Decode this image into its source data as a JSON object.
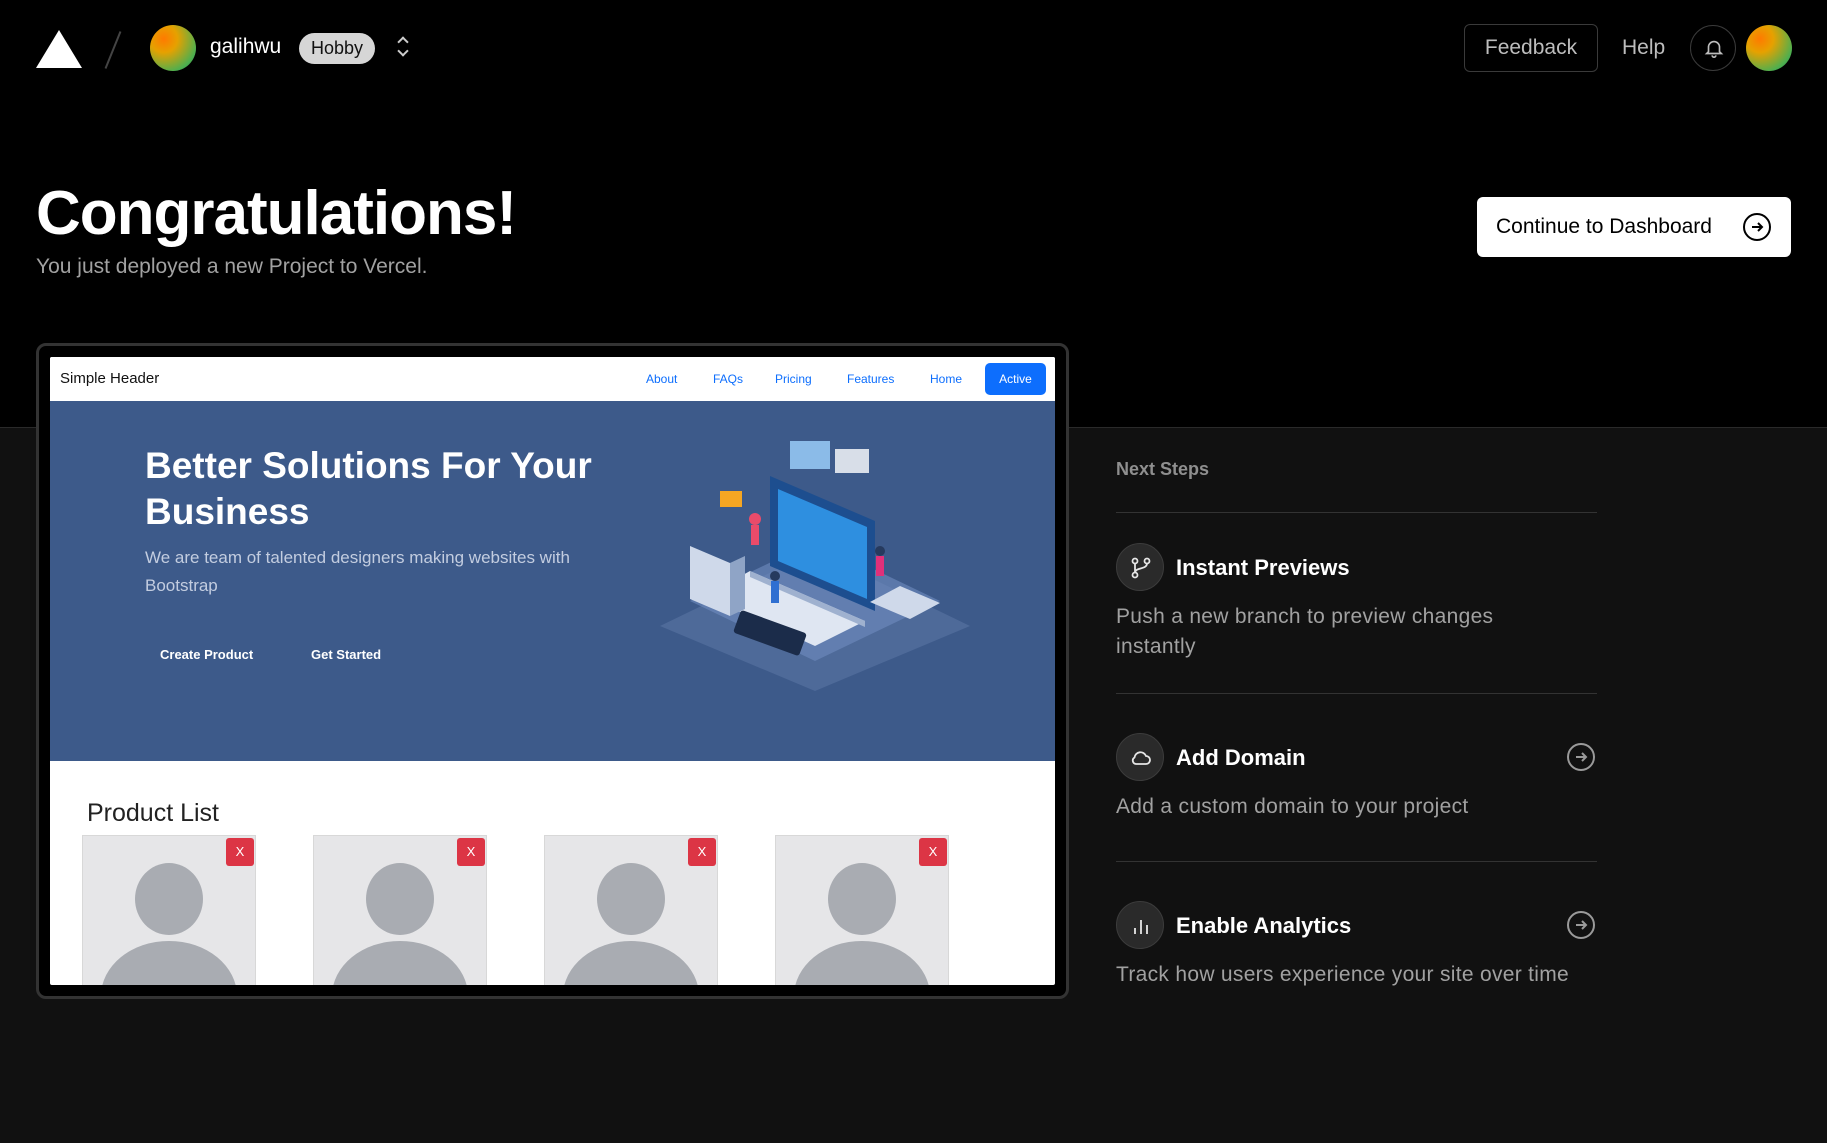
{
  "header": {
    "team_name": "galihwu",
    "plan_badge": "Hobby",
    "feedback_label": "Feedback",
    "help_label": "Help"
  },
  "hero": {
    "title": "Congratulations!",
    "subtitle": "You just deployed a new Project to Vercel.",
    "cta_label": "Continue to Dashboard"
  },
  "preview": {
    "brand": "Simple Header",
    "nav_links": [
      "About",
      "FAQs",
      "Pricing",
      "Features",
      "Home"
    ],
    "nav_active": "Active",
    "headline": "Better Solutions For Your Business",
    "lead": "We are team of talented designers making websites with Bootstrap",
    "buttons": [
      "Create Product",
      "Get Started"
    ],
    "products_title": "Product List",
    "delete_label": "X"
  },
  "next_steps": {
    "title": "Next Steps",
    "items": [
      {
        "title": "Instant Previews",
        "description": "Push a new branch to preview changes instantly",
        "icon": "git-branch-icon"
      },
      {
        "title": "Add Domain",
        "description": "Add a custom domain to your project",
        "icon": "cloud-icon"
      },
      {
        "title": "Enable Analytics",
        "description": "Track how users experience your site over time",
        "icon": "bar-chart-icon"
      }
    ]
  },
  "colors": {
    "page_bg": "#111111",
    "top_bg": "#000000",
    "preview_hero_bg": "#3d5a8a",
    "link_blue": "#0d6efd",
    "delete_red": "#dc3545"
  }
}
